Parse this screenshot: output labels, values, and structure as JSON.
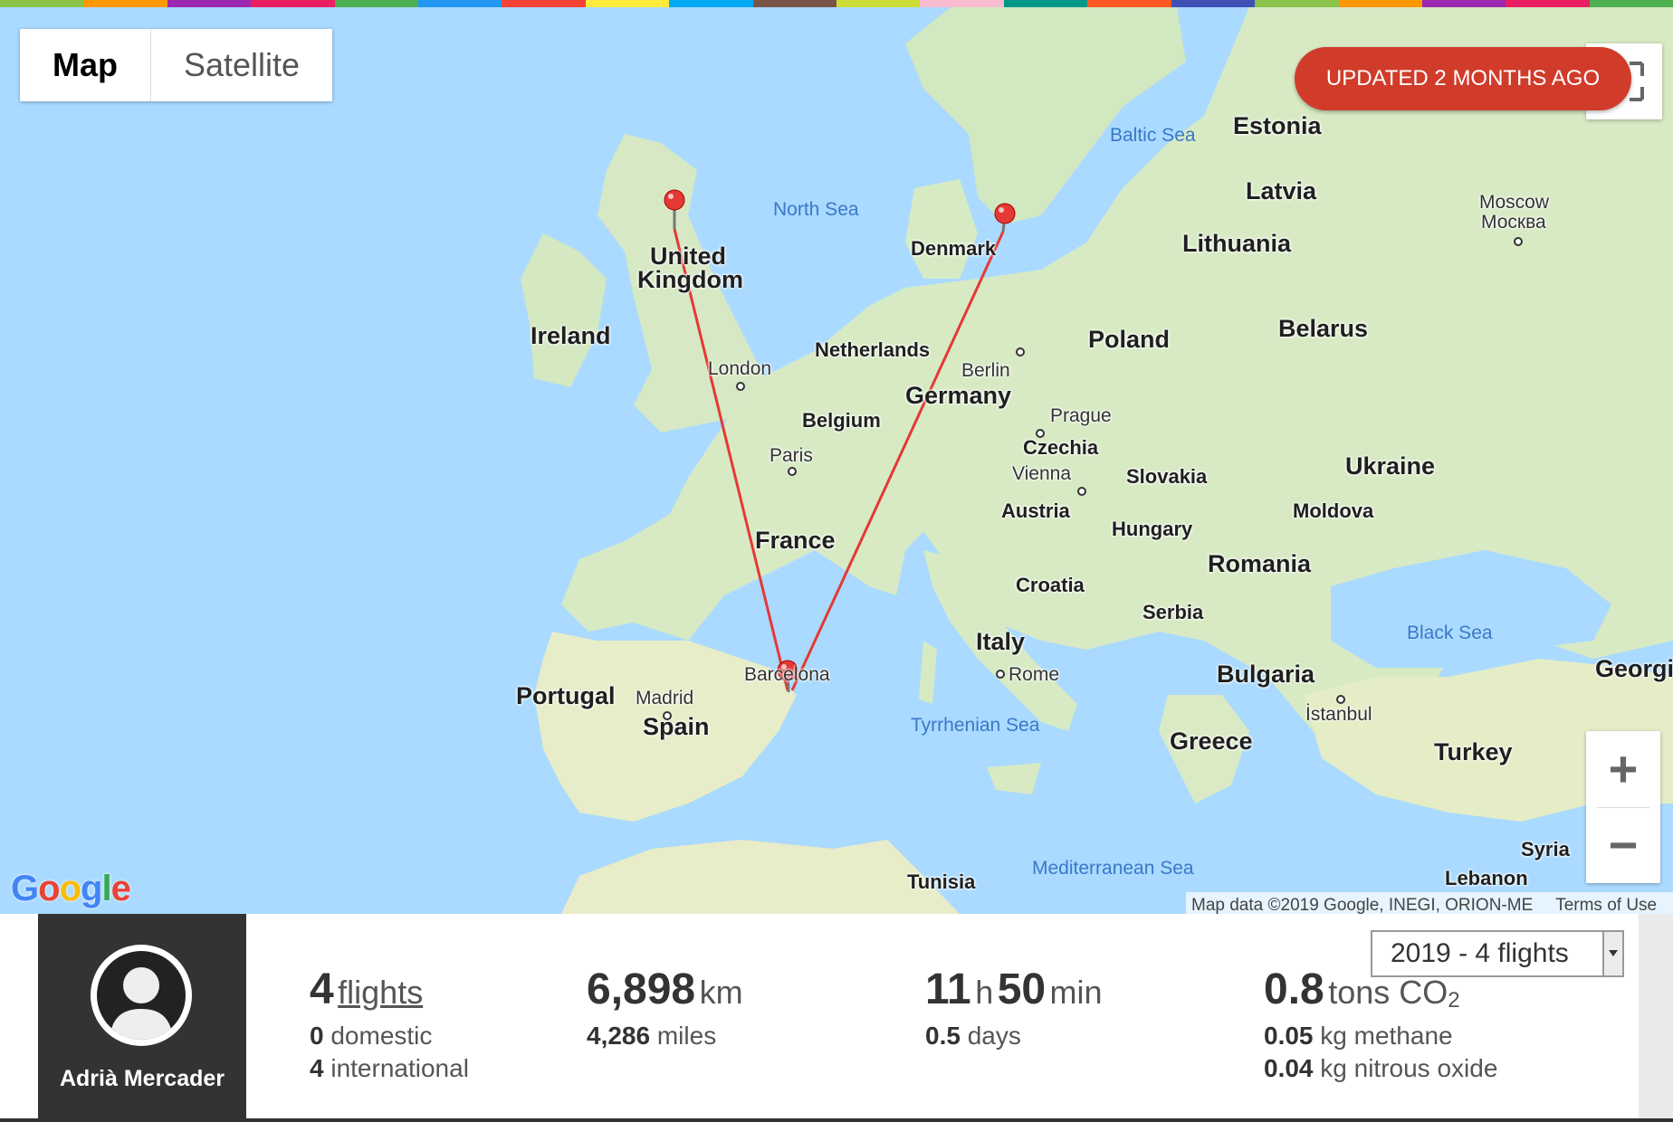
{
  "top_bar_colors": [
    "#8bc34a",
    "#ff9800",
    "#9c27b0",
    "#e91e63",
    "#4caf50",
    "#2196f3",
    "#f44336",
    "#ffeb3b",
    "#03a9f4",
    "#795548",
    "#cddc39",
    "#f8bbd0",
    "#009688",
    "#ff5722",
    "#3f51b5",
    "#8bc34a",
    "#ff9800",
    "#9c27b0",
    "#e91e63",
    "#4caf50"
  ],
  "map": {
    "type_control": {
      "map_label": "Map",
      "satellite_label": "Satellite"
    },
    "updated_badge": "UPDATED 2 MONTHS AGO",
    "google_logo": [
      "G",
      "o",
      "o",
      "g",
      "l",
      "e"
    ],
    "google_colors": [
      "#4285f4",
      "#ea4335",
      "#fbbc05",
      "#4285f4",
      "#34a853",
      "#ea4335"
    ],
    "attribution": {
      "data": "Map data ©2019 Google, INEGI, ORION-ME",
      "terms": "Terms of Use"
    },
    "zoom": {
      "in": "+",
      "out": "−"
    },
    "labels": {
      "north_sea": "North Sea",
      "baltic_sea": "Baltic Sea",
      "black_sea": "Black Sea",
      "tyrrhenian_sea": "Tyrrhenian Sea",
      "mediterranean_sea": "Mediterranean Sea",
      "estonia": "Estonia",
      "latvia": "Latvia",
      "lithuania": "Lithuania",
      "belarus": "Belarus",
      "poland": "Poland",
      "ukraine": "Ukraine",
      "moldova": "Moldova",
      "romania": "Romania",
      "bulgaria": "Bulgaria",
      "greece": "Greece",
      "turkey": "Turkey",
      "georgia": "Georgi",
      "syria": "Syria",
      "lebanon": "Lebanon",
      "moscow": "Moscow",
      "moscow_ru": "Москва",
      "denmark": "Denmark",
      "united": "United",
      "kingdom": "Kingdom",
      "ireland": "Ireland",
      "london": "London",
      "netherlands": "Netherlands",
      "belgium": "Belgium",
      "germany": "Germany",
      "berlin": "Berlin",
      "prague": "Prague",
      "czechia": "Czechia",
      "vienna": "Vienna",
      "austria": "Austria",
      "slovakia": "Slovakia",
      "hungary": "Hungary",
      "croatia": "Croatia",
      "serbia": "Serbia",
      "paris": "Paris",
      "france": "France",
      "italy": "Italy",
      "rome": "Rome",
      "barcelona": "Barcelona",
      "madrid": "Madrid",
      "spain": "Spain",
      "portugal": "Portugal",
      "istanbul": "İstanbul",
      "tunisia": "Tunisia"
    }
  },
  "profile": {
    "name": "Adrià Mercader"
  },
  "year_select": "2019 - 4 flights",
  "stats": {
    "flights": {
      "count": "4",
      "label": "flights",
      "domestic_n": "0",
      "domestic": "domestic",
      "international_n": "4",
      "international": "international"
    },
    "distance": {
      "km": "6,898",
      "km_unit": "km",
      "miles": "4,286",
      "miles_unit": "miles"
    },
    "time": {
      "h": "11",
      "h_unit": "h",
      "min": "50",
      "min_unit": "min",
      "days": "0.5",
      "days_unit": "days"
    },
    "emissions": {
      "co2": "0.8",
      "co2_unit": "tons CO",
      "co2_sub": "2",
      "methane": "0.05",
      "methane_unit": "kg methane",
      "n2o": "0.04",
      "n2o_unit": "kg nitrous oxide"
    }
  }
}
